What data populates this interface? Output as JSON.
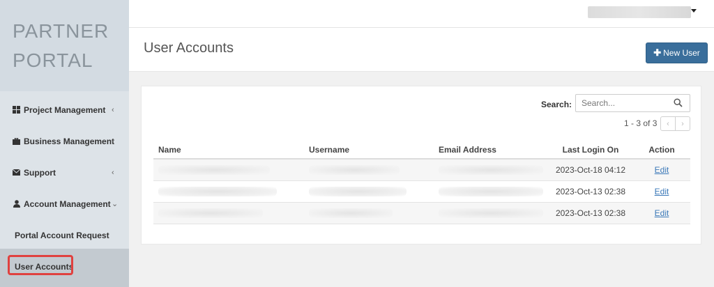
{
  "brand": {
    "line1": "PARTNER",
    "line2": "PORTAL"
  },
  "sidebar": {
    "items": [
      {
        "label": "Project Management",
        "icon": "grid-icon",
        "chevron": "‹"
      },
      {
        "label": "Business Management",
        "icon": "briefcase-icon",
        "chevron": "‹"
      },
      {
        "label": "Support",
        "icon": "envelope-icon",
        "chevron": "‹"
      },
      {
        "label": "Account Management",
        "icon": "user-icon",
        "chevron": "⌄"
      }
    ],
    "subitems": [
      {
        "label": "Portal Account Request"
      },
      {
        "label": "User Accounts",
        "active": true
      }
    ]
  },
  "header": {
    "title": "User Accounts",
    "new_user_label": "New User"
  },
  "search": {
    "label": "Search:",
    "placeholder": "Search..."
  },
  "pagination": {
    "info": "1 - 3 of 3",
    "prev": "‹",
    "next": "›"
  },
  "table": {
    "columns": [
      "Name",
      "Username",
      "Email Address",
      "Last Login On",
      "Action"
    ],
    "rows": [
      {
        "last_login": "2023-Oct-18 04:12",
        "action": "Edit"
      },
      {
        "last_login": "2023-Oct-13 02:38",
        "action": "Edit"
      },
      {
        "last_login": "2023-Oct-13 02:38",
        "action": "Edit"
      }
    ]
  },
  "colors": {
    "accent": "#3a6e9b",
    "sidebar_bg": "#dde3e8",
    "highlight": "#e0413f"
  }
}
